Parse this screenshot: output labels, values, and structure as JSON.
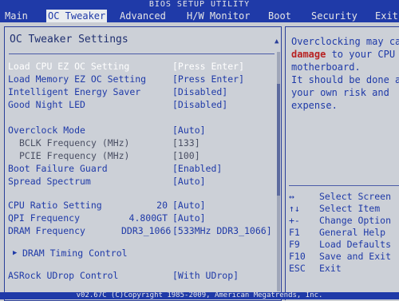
{
  "title": "BIOS SETUP UTILITY",
  "menu": [
    {
      "label": "Main"
    },
    {
      "label": "OC Tweaker",
      "active": true
    },
    {
      "label": "Advanced"
    },
    {
      "label": "H/W Monitor"
    },
    {
      "label": "Boot"
    },
    {
      "label": "Security"
    },
    {
      "label": "Exit"
    }
  ],
  "panel_title": "OC Tweaker Settings",
  "settings": [
    {
      "label": "Load CPU EZ OC Setting",
      "value": "[Press Enter]",
      "selected": true
    },
    {
      "label": "Load Memory EZ OC Setting",
      "value": "[Press Enter]"
    },
    {
      "label": "Intelligent Energy Saver",
      "value": "[Disabled]"
    },
    {
      "label": "Good Night LED",
      "value": "[Disabled]"
    },
    {
      "label": "Overclock Mode",
      "value": "[Auto]"
    },
    {
      "label": "BCLK Frequency (MHz)",
      "value": "[133]",
      "sub": true
    },
    {
      "label": "PCIE Frequency (MHz)",
      "value": "[100]",
      "sub": true
    },
    {
      "label": "Boot Failure Guard",
      "value": "[Enabled]"
    },
    {
      "label": "Spread Spectrum",
      "value": "[Auto]"
    },
    {
      "label": "CPU Ratio Setting",
      "mid": "20",
      "value": "[Auto]"
    },
    {
      "label": "QPI Frequency",
      "mid": "4.800GT",
      "value": "[Auto]"
    },
    {
      "label": "DRAM Frequency",
      "mid": "DDR3_1066",
      "value": "[533MHz DDR3_1066]"
    },
    {
      "label": "DRAM Timing Control",
      "value": "",
      "submenu": true
    },
    {
      "label": "ASRock UDrop Control",
      "value": "[With UDrop]"
    }
  ],
  "help": {
    "lines": [
      {
        "text": "Overclocking may cau"
      },
      {
        "text": "damage",
        "warn": true,
        "rest": " to your CPU an"
      },
      {
        "text": "motherboard."
      },
      {
        "text": "It should be done at"
      },
      {
        "text": "your own risk and"
      },
      {
        "text": "expense."
      }
    ],
    "keys": [
      {
        "key": "↔",
        "desc": "Select Screen"
      },
      {
        "key": "↑↓",
        "desc": "Select Item"
      },
      {
        "key": "+-",
        "desc": "Change Option"
      },
      {
        "key": "F1",
        "desc": "General Help"
      },
      {
        "key": "F9",
        "desc": "Load Defaults"
      },
      {
        "key": "F10",
        "desc": "Save and Exit"
      },
      {
        "key": "ESC",
        "desc": "Exit"
      }
    ]
  },
  "footer": "v02.67C (C)Copyright 1985-2009, American Megatrends, Inc."
}
